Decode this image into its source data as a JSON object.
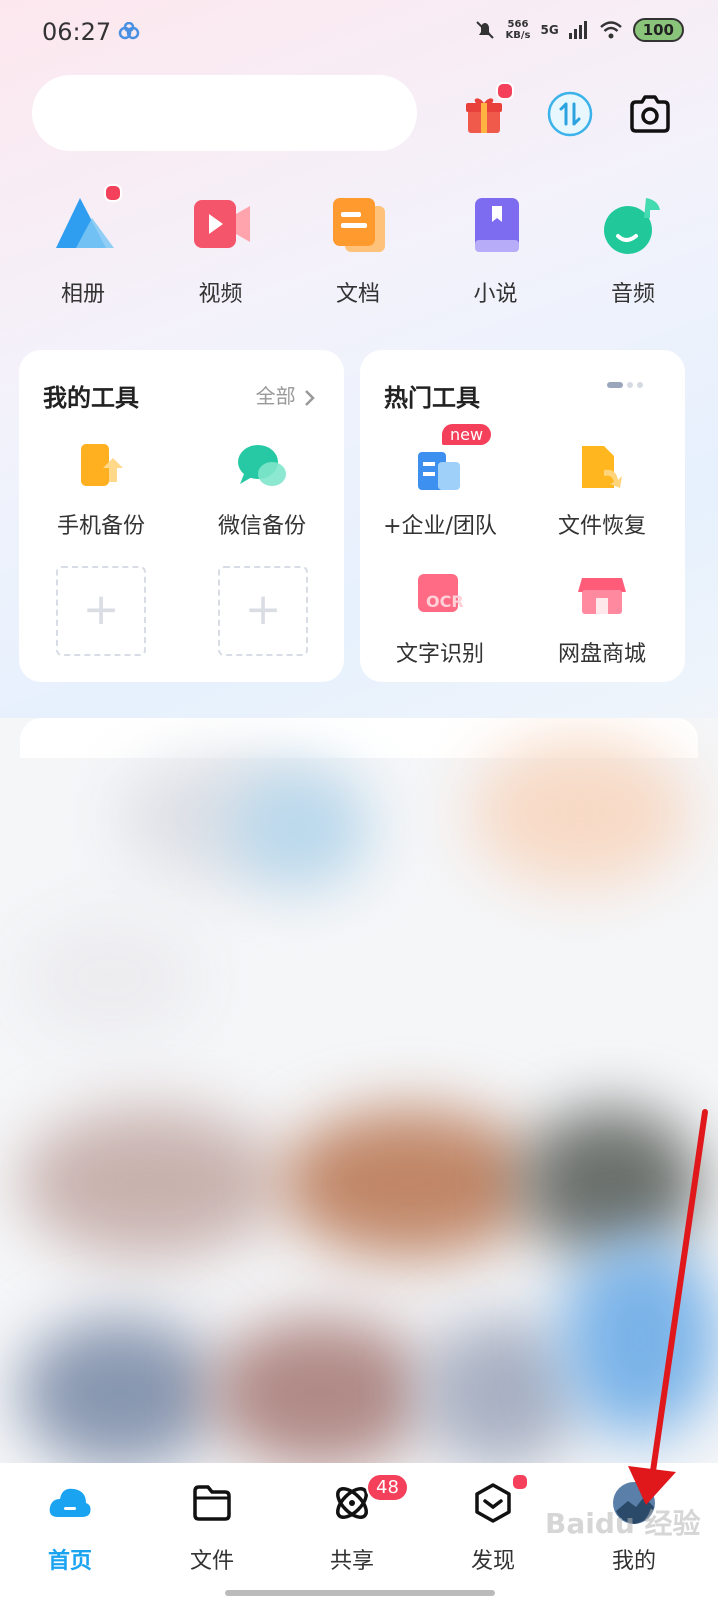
{
  "status_bar": {
    "time": "06:27",
    "speed_value": "566",
    "speed_unit": "KB/s",
    "network": "5G",
    "battery": "100"
  },
  "categories": [
    {
      "label": "相册",
      "icon": "album-icon",
      "has_dot": true
    },
    {
      "label": "视频",
      "icon": "video-icon",
      "has_dot": false
    },
    {
      "label": "文档",
      "icon": "document-icon",
      "has_dot": false
    },
    {
      "label": "小说",
      "icon": "novel-icon",
      "has_dot": false
    },
    {
      "label": "音频",
      "icon": "audio-icon",
      "has_dot": false
    }
  ],
  "my_tools": {
    "title": "我的工具",
    "more_label": "全部",
    "items": [
      {
        "label": "手机备份",
        "icon": "phone-backup-icon"
      },
      {
        "label": "微信备份",
        "icon": "wechat-backup-icon"
      }
    ]
  },
  "hot_tools": {
    "title": "热门工具",
    "items": [
      {
        "label": "+企业/团队",
        "icon": "enterprise-team-icon",
        "badge": "new"
      },
      {
        "label": "文件恢复",
        "icon": "file-restore-icon"
      },
      {
        "label": "文字识别",
        "icon": "ocr-icon",
        "icon_text": "OCR"
      },
      {
        "label": "网盘商城",
        "icon": "store-icon"
      }
    ]
  },
  "tabbar": {
    "items": [
      {
        "label": "首页",
        "icon": "home-cloud-icon",
        "active": true
      },
      {
        "label": "文件",
        "icon": "folder-icon"
      },
      {
        "label": "共享",
        "icon": "share-orbit-icon",
        "badge": "48"
      },
      {
        "label": "发现",
        "icon": "discover-box-icon",
        "has_dot": true
      },
      {
        "label": "我的",
        "icon": "avatar-icon"
      }
    ]
  },
  "watermark": "Baidu 经验",
  "colors": {
    "accent": "#1aa3f0",
    "badge_red": "#f4405a",
    "annotation_arrow": "#e0171b"
  }
}
